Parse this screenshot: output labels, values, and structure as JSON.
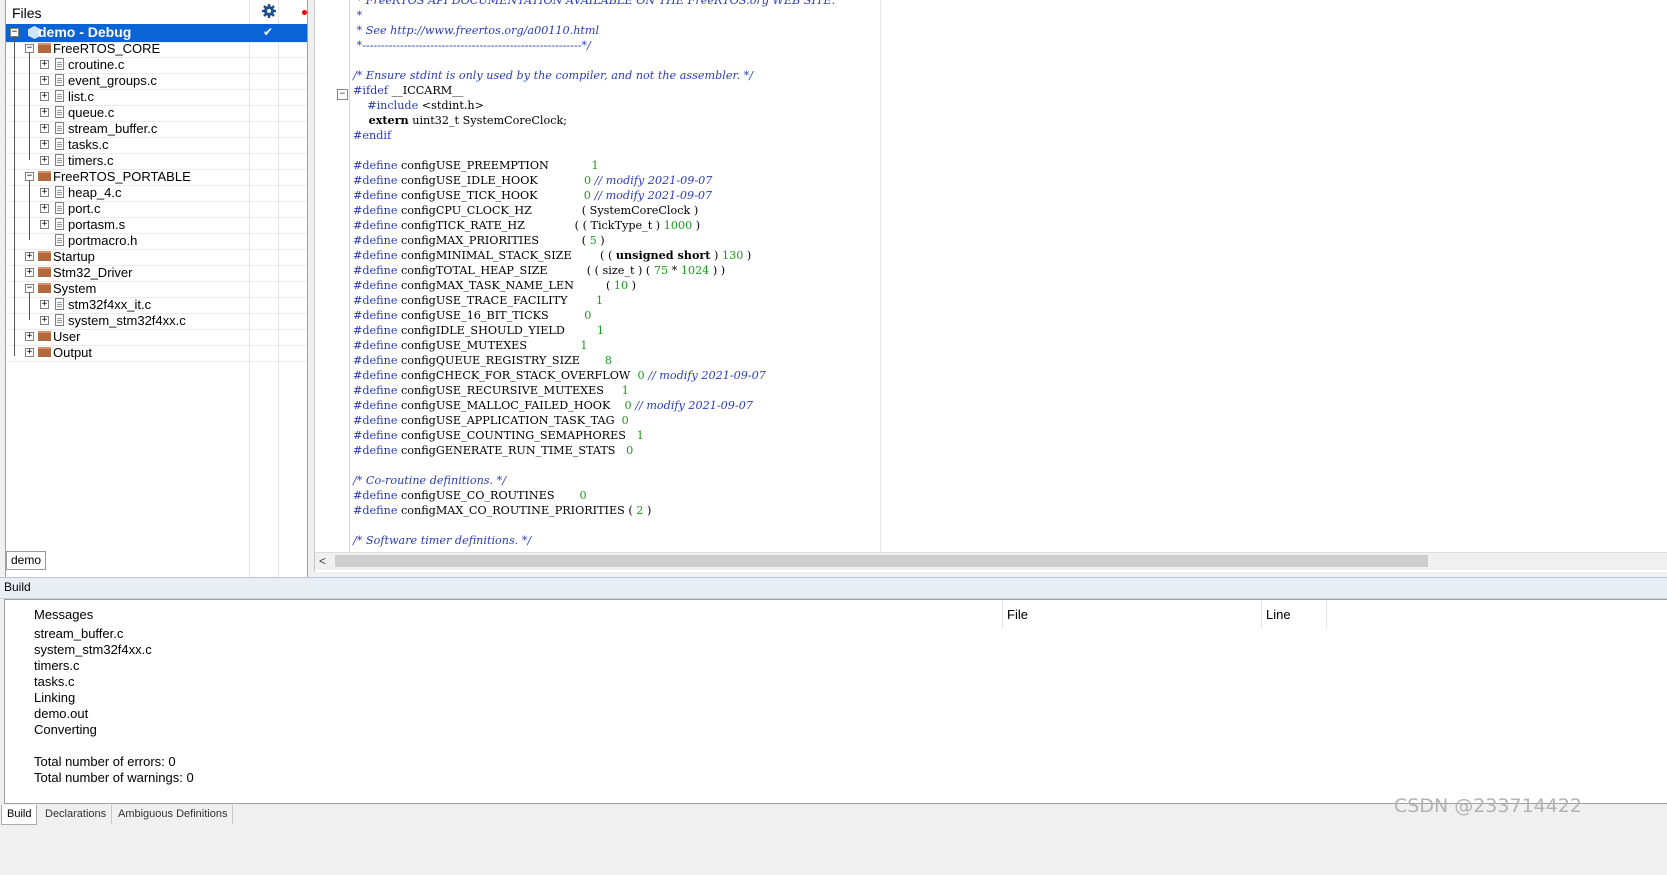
{
  "files_panel": {
    "title": "Files",
    "tab_label": "demo",
    "icons": {
      "settings": "gear-icon",
      "breakpoint": "red-dot-icon"
    },
    "tree": [
      {
        "label": "demo - Debug",
        "type": "project",
        "selected": true,
        "check": "✔"
      },
      {
        "label": "FreeRTOS_CORE",
        "type": "folder",
        "expanded": true
      },
      {
        "label": "croutine.c",
        "type": "file"
      },
      {
        "label": "event_groups.c",
        "type": "file"
      },
      {
        "label": "list.c",
        "type": "file"
      },
      {
        "label": "queue.c",
        "type": "file"
      },
      {
        "label": "stream_buffer.c",
        "type": "file"
      },
      {
        "label": "tasks.c",
        "type": "file"
      },
      {
        "label": "timers.c",
        "type": "file"
      },
      {
        "label": "FreeRTOS_PORTABLE",
        "type": "folder",
        "expanded": true
      },
      {
        "label": "heap_4.c",
        "type": "file"
      },
      {
        "label": "port.c",
        "type": "file"
      },
      {
        "label": "portasm.s",
        "type": "file"
      },
      {
        "label": "portmacro.h",
        "type": "file"
      },
      {
        "label": "Startup",
        "type": "folder",
        "expanded": false
      },
      {
        "label": "Stm32_Driver",
        "type": "folder",
        "expanded": false
      },
      {
        "label": "System",
        "type": "folder",
        "expanded": true
      },
      {
        "label": "stm32f4xx_it.c",
        "type": "file"
      },
      {
        "label": "system_stm32f4xx.c",
        "type": "file"
      },
      {
        "label": "User",
        "type": "folder",
        "expanded": false
      },
      {
        "label": "Output",
        "type": "folder",
        "expanded": false
      }
    ]
  },
  "editor": {
    "lines": [
      [
        [
          "cm",
          " * FreeRTOS API DOCUMENTATION AVAILABLE ON THE FreeRTOS.org WEB SITE."
        ]
      ],
      [
        [
          "cm",
          " *"
        ]
      ],
      [
        [
          "cm",
          " * See http://www.freertos.org/a00110.html"
        ]
      ],
      [
        [
          "cm",
          " *----------------------------------------------------------*/"
        ]
      ],
      [
        [
          "",
          ""
        ]
      ],
      [
        [
          "cm",
          "/* Ensure stdint is only used by the compiler, and not the assembler. */"
        ]
      ],
      [
        [
          "pp",
          "#ifdef"
        ],
        [
          "",
          " __ICCARM__"
        ]
      ],
      [
        [
          "pp",
          "    #include"
        ],
        [
          "",
          " <stdint.h>"
        ]
      ],
      [
        [
          "kw",
          "    extern"
        ],
        [
          "",
          " uint32_t SystemCoreClock;"
        ]
      ],
      [
        [
          "pp",
          "#endif"
        ]
      ],
      [
        [
          "",
          ""
        ]
      ],
      [
        [
          "pp",
          "#define"
        ],
        [
          "",
          " configUSE_PREEMPTION            "
        ],
        [
          "num",
          "1"
        ]
      ],
      [
        [
          "pp",
          "#define"
        ],
        [
          "",
          " configUSE_IDLE_HOOK             "
        ],
        [
          "num",
          "0"
        ],
        [
          "",
          " "
        ],
        [
          "cm",
          "// modify 2021-09-07"
        ]
      ],
      [
        [
          "pp",
          "#define"
        ],
        [
          "",
          " configUSE_TICK_HOOK             "
        ],
        [
          "num",
          "0"
        ],
        [
          "",
          " "
        ],
        [
          "cm",
          "// modify 2021-09-07"
        ]
      ],
      [
        [
          "pp",
          "#define"
        ],
        [
          "",
          " configCPU_CLOCK_HZ              ( SystemCoreClock )"
        ]
      ],
      [
        [
          "pp",
          "#define"
        ],
        [
          "",
          " configTICK_RATE_HZ              ( ( TickType_t ) "
        ],
        [
          "num",
          "1000"
        ],
        [
          "",
          " )"
        ]
      ],
      [
        [
          "pp",
          "#define"
        ],
        [
          "",
          " configMAX_PRIORITIES            ( "
        ],
        [
          "num",
          "5"
        ],
        [
          "",
          " )"
        ]
      ],
      [
        [
          "pp",
          "#define"
        ],
        [
          "",
          " configMINIMAL_STACK_SIZE        ( ( "
        ],
        [
          "kw",
          "unsigned short"
        ],
        [
          "",
          " ) "
        ],
        [
          "num",
          "130"
        ],
        [
          "",
          " )"
        ]
      ],
      [
        [
          "pp",
          "#define"
        ],
        [
          "",
          " configTOTAL_HEAP_SIZE           ( ( size_t ) ( "
        ],
        [
          "num",
          "75"
        ],
        [
          "",
          " * "
        ],
        [
          "num",
          "1024"
        ],
        [
          "",
          " ) )"
        ]
      ],
      [
        [
          "pp",
          "#define"
        ],
        [
          "",
          " configMAX_TASK_NAME_LEN         ( "
        ],
        [
          "num",
          "10"
        ],
        [
          "",
          " )"
        ]
      ],
      [
        [
          "pp",
          "#define"
        ],
        [
          "",
          " configUSE_TRACE_FACILITY        "
        ],
        [
          "num",
          "1"
        ]
      ],
      [
        [
          "pp",
          "#define"
        ],
        [
          "",
          " configUSE_16_BIT_TICKS          "
        ],
        [
          "num",
          "0"
        ]
      ],
      [
        [
          "pp",
          "#define"
        ],
        [
          "",
          " configIDLE_SHOULD_YIELD         "
        ],
        [
          "num",
          "1"
        ]
      ],
      [
        [
          "pp",
          "#define"
        ],
        [
          "",
          " configUSE_MUTEXES               "
        ],
        [
          "num",
          "1"
        ]
      ],
      [
        [
          "pp",
          "#define"
        ],
        [
          "",
          " configQUEUE_REGISTRY_SIZE       "
        ],
        [
          "num",
          "8"
        ]
      ],
      [
        [
          "pp",
          "#define"
        ],
        [
          "",
          " configCHECK_FOR_STACK_OVERFLOW  "
        ],
        [
          "num",
          "0"
        ],
        [
          "",
          " "
        ],
        [
          "cm",
          "// modify 2021-09-07"
        ]
      ],
      [
        [
          "pp",
          "#define"
        ],
        [
          "",
          " configUSE_RECURSIVE_MUTEXES     "
        ],
        [
          "num",
          "1"
        ]
      ],
      [
        [
          "pp",
          "#define"
        ],
        [
          "",
          " configUSE_MALLOC_FAILED_HOOK    "
        ],
        [
          "num",
          "0"
        ],
        [
          "",
          " "
        ],
        [
          "cm",
          "// modify 2021-09-07"
        ]
      ],
      [
        [
          "pp",
          "#define"
        ],
        [
          "",
          " configUSE_APPLICATION_TASK_TAG  "
        ],
        [
          "num",
          "0"
        ]
      ],
      [
        [
          "pp",
          "#define"
        ],
        [
          "",
          " configUSE_COUNTING_SEMAPHORES   "
        ],
        [
          "num",
          "1"
        ]
      ],
      [
        [
          "pp",
          "#define"
        ],
        [
          "",
          " configGENERATE_RUN_TIME_STATS   "
        ],
        [
          "num",
          "0"
        ]
      ],
      [
        [
          "",
          ""
        ]
      ],
      [
        [
          "cm",
          "/* Co-routine definitions. */"
        ]
      ],
      [
        [
          "pp",
          "#define"
        ],
        [
          "",
          " configUSE_CO_ROUTINES       "
        ],
        [
          "num",
          "0"
        ]
      ],
      [
        [
          "pp",
          "#define"
        ],
        [
          "",
          " configMAX_CO_ROUTINE_PRIORITIES ( "
        ],
        [
          "num",
          "2"
        ],
        [
          "",
          " )"
        ]
      ],
      [
        [
          "",
          ""
        ]
      ],
      [
        [
          "cm",
          "/* Software timer definitions. */"
        ]
      ]
    ],
    "scroll_left_arrow": "<"
  },
  "build": {
    "panel_title": "Build",
    "columns": {
      "messages": "Messages",
      "file": "File",
      "line": "Line"
    },
    "messages": [
      "stream_buffer.c",
      "system_stm32f4xx.c",
      "timers.c",
      "tasks.c",
      "Linking",
      "demo.out",
      "Converting",
      "",
      "Total number of errors: 0",
      "Total number of warnings: 0"
    ]
  },
  "bottom_tabs": [
    "Build",
    "Declarations",
    "Ambiguous Definitions"
  ],
  "watermark": "CSDN @233714422",
  "colors": {
    "selection": "#0a64d6",
    "comment": "#2a3cb6",
    "number": "#1c9b1c"
  }
}
